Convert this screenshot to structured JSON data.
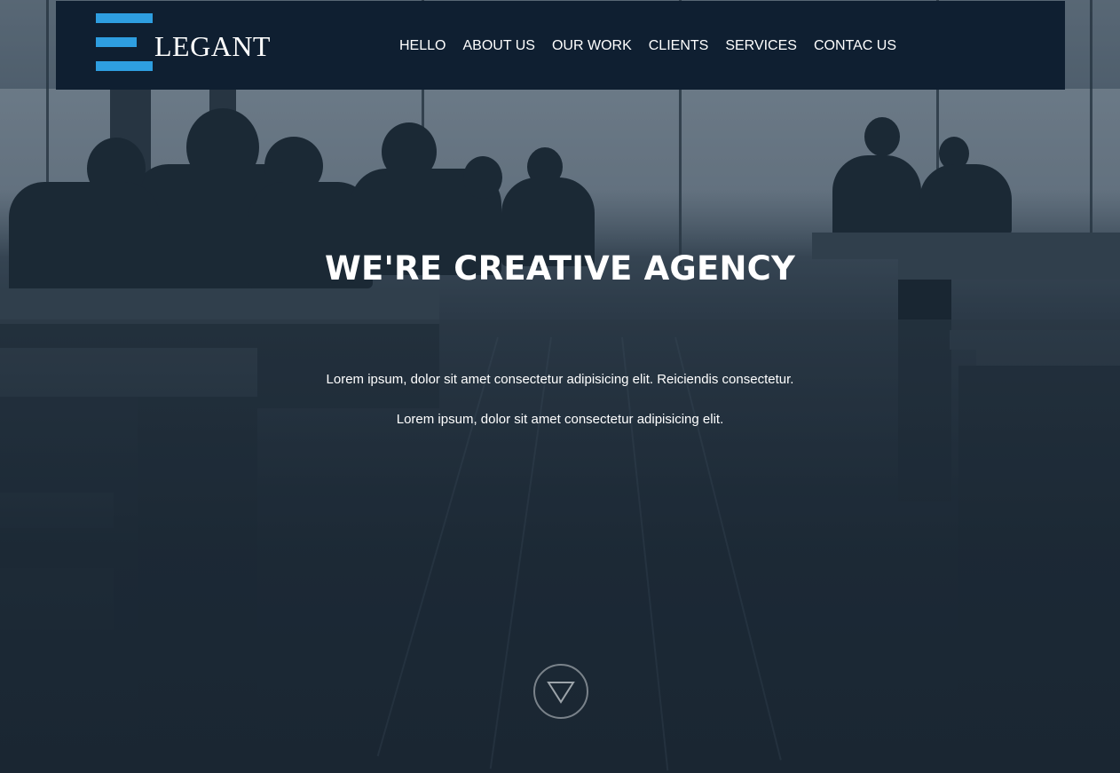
{
  "brand": {
    "logo_text": "LEGANT",
    "accent_color": "#2e9ee0",
    "navbar_color": "#0f1f31"
  },
  "nav": {
    "items": [
      {
        "label": "HELLO"
      },
      {
        "label": "ABOUT US"
      },
      {
        "label": "OUR WORK"
      },
      {
        "label": "CLIENTS"
      },
      {
        "label": "SERVICES"
      },
      {
        "label": "CONTAC US"
      }
    ]
  },
  "hero": {
    "title": "WE'RE CREATIVE AGENCY",
    "paragraph_1": "Lorem ipsum, dolor sit amet consectetur adipisicing elit. Reiciendis consectetur.",
    "paragraph_2": "Lorem ipsum, dolor sit amet consectetur adipisicing elit.",
    "scroll_icon": "triangle-down-icon"
  }
}
